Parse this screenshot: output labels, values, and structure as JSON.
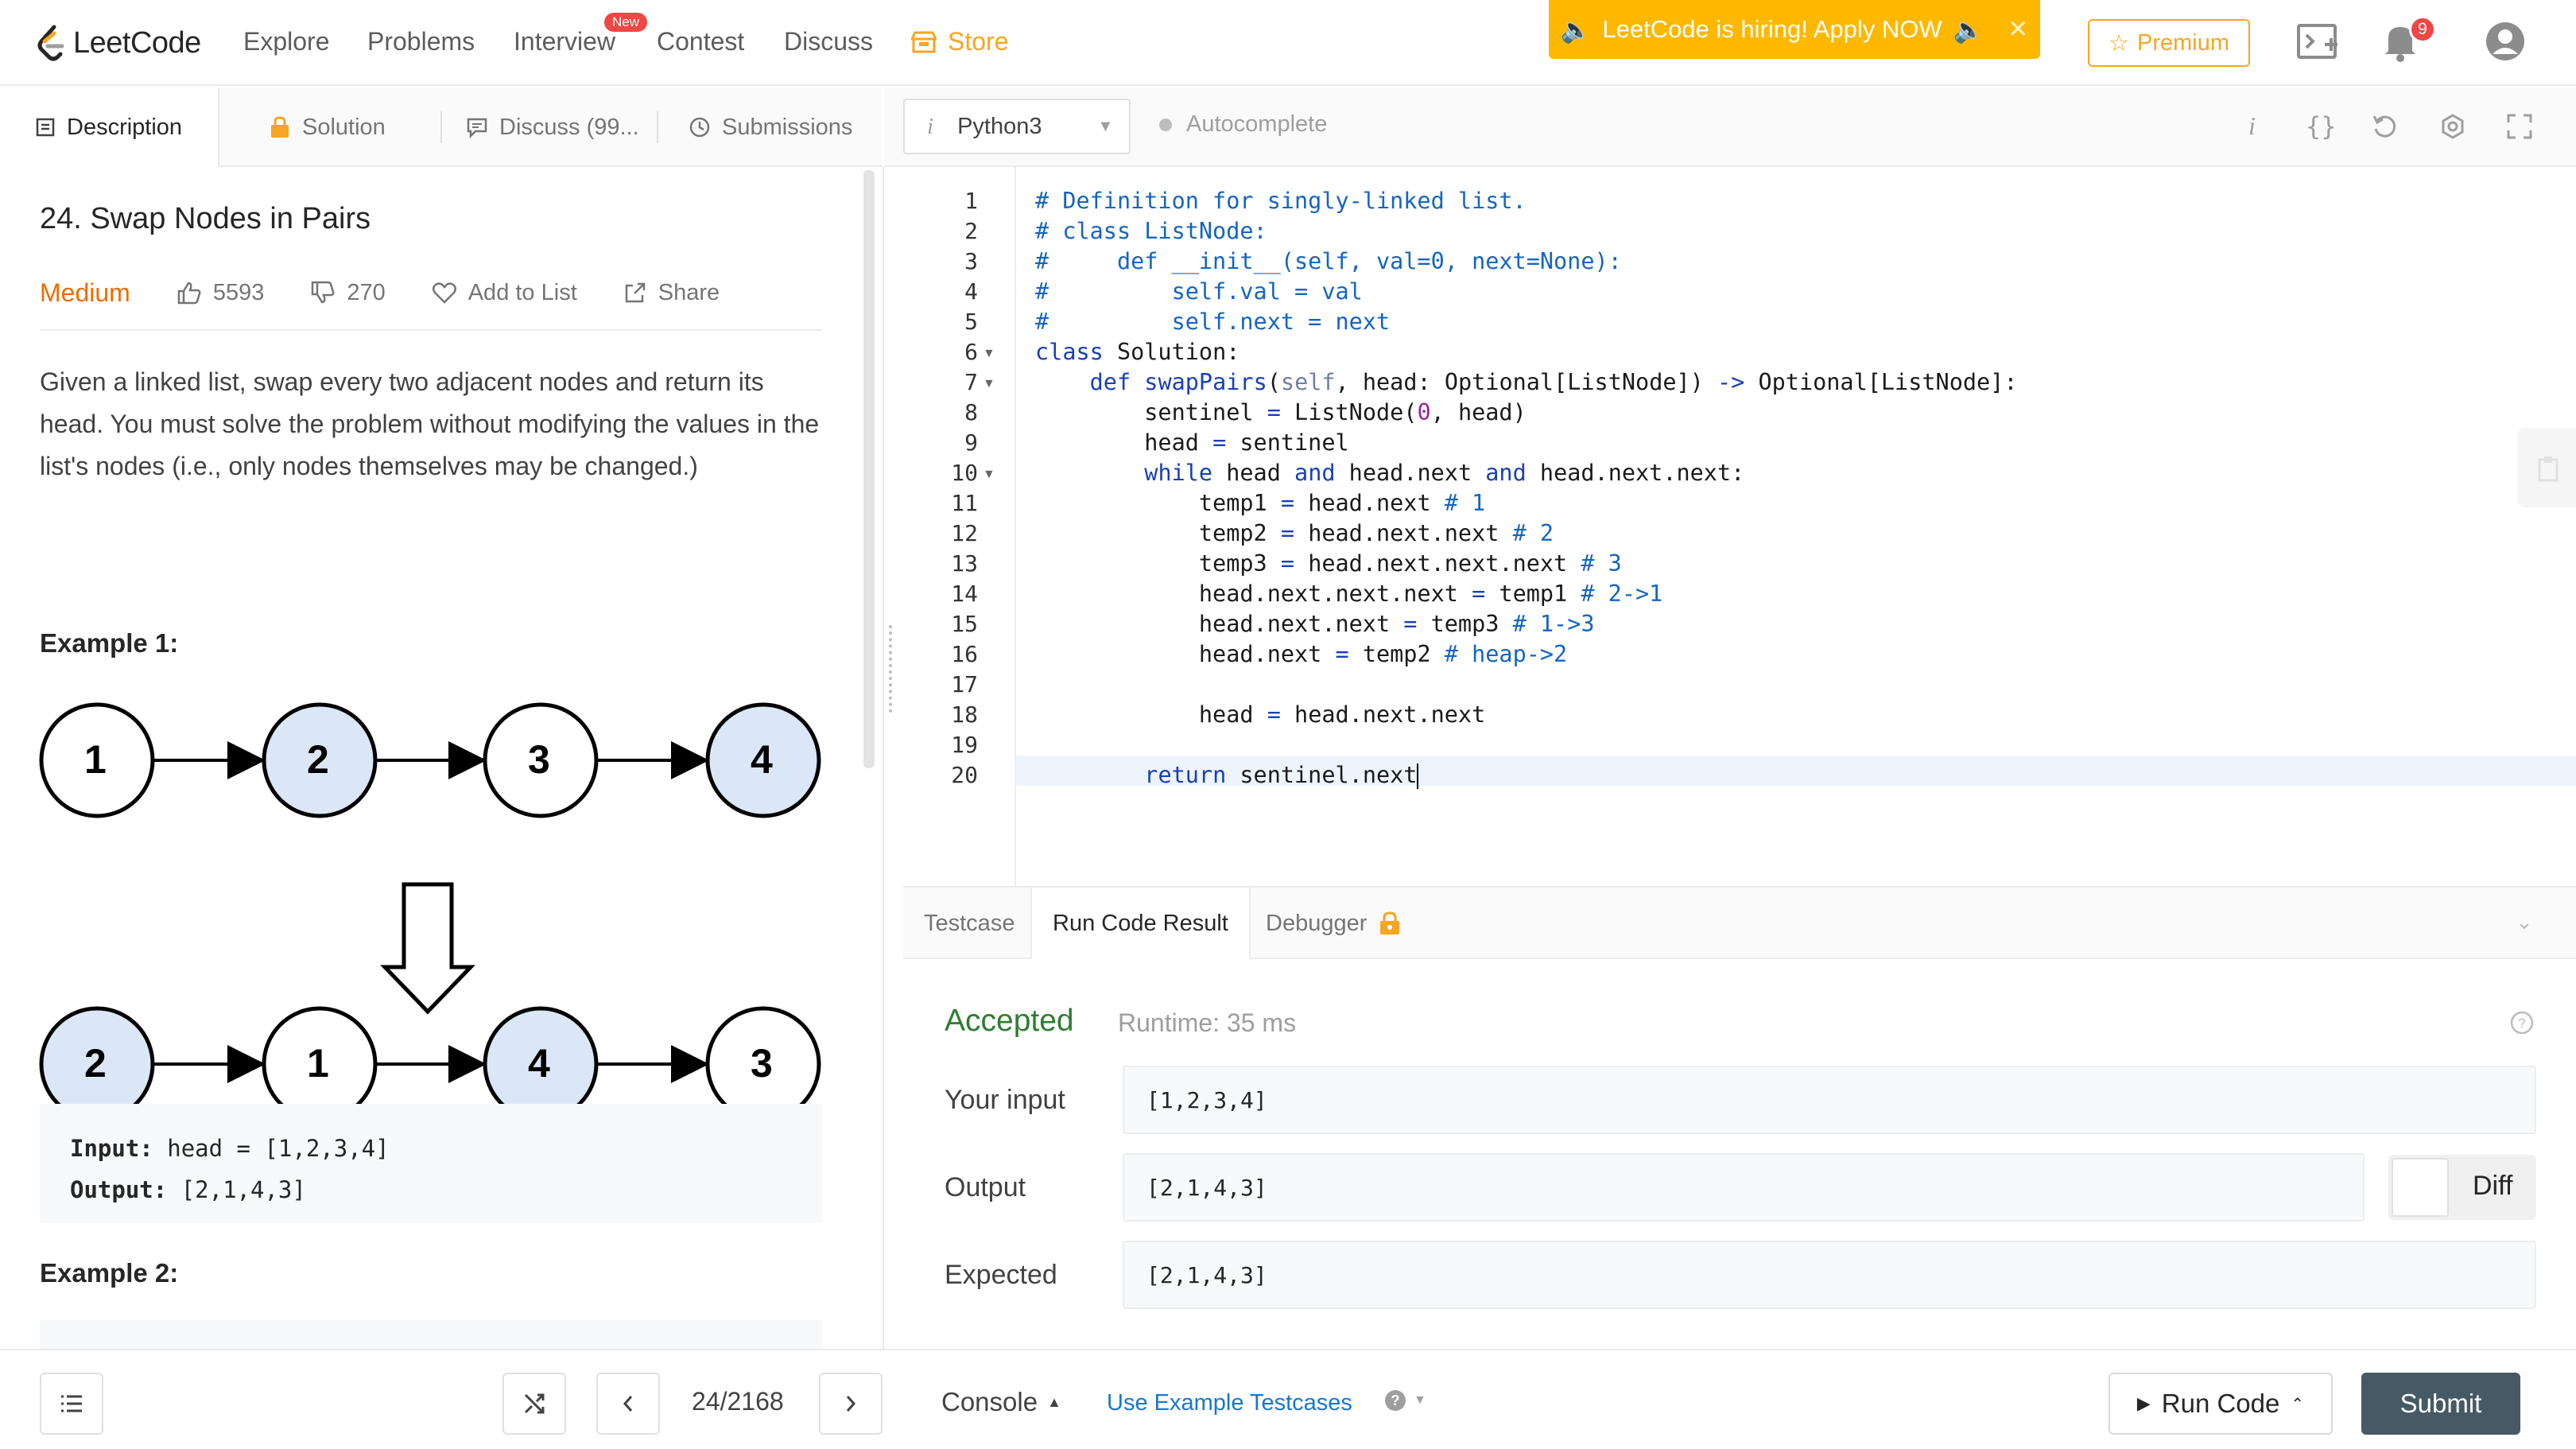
{
  "nav": {
    "logo_text": "LeetCode",
    "items": [
      "Explore",
      "Problems",
      "Interview",
      "Contest",
      "Discuss",
      "Store"
    ],
    "new_badge": "New",
    "hiring_banner": "LeetCode is hiring! Apply NOW",
    "premium_label": "Premium",
    "notification_count": "9"
  },
  "left_tabs": {
    "description": "Description",
    "solution": "Solution",
    "discuss": "Discuss (99...",
    "submissions": "Submissions"
  },
  "problem": {
    "title": "24. Swap Nodes in Pairs",
    "difficulty": "Medium",
    "likes": "5593",
    "dislikes": "270",
    "add_to_list": "Add to List",
    "share": "Share",
    "description": "Given a linked list, swap every two adjacent nodes and return its head. You must solve the problem without modifying the values in the list's nodes (i.e., only nodes themselves may be changed.)",
    "example1_heading": "Example 1:",
    "example2_heading": "Example 2:",
    "diagram_before": [
      "1",
      "2",
      "3",
      "4"
    ],
    "diagram_after": [
      "2",
      "1",
      "4",
      "3"
    ],
    "example1_input_label": "Input:",
    "example1_input": "head = [1,2,3,4]",
    "example1_output_label": "Output:",
    "example1_output": "[2,1,4,3]"
  },
  "editor": {
    "language": "Python3",
    "autocomplete": "Autocomplete",
    "line_numbers": [
      "1",
      "2",
      "3",
      "4",
      "5",
      "6",
      "7",
      "8",
      "9",
      "10",
      "11",
      "12",
      "13",
      "14",
      "15",
      "16",
      "17",
      "18",
      "19",
      "20"
    ]
  },
  "result_tabs": {
    "testcase": "Testcase",
    "run_code_result": "Run Code Result",
    "debugger": "Debugger"
  },
  "result": {
    "status": "Accepted",
    "runtime": "Runtime: 35 ms",
    "your_input_label": "Your input",
    "your_input": "[1,2,3,4]",
    "output_label": "Output",
    "output": "[2,1,4,3]",
    "expected_label": "Expected",
    "expected": "[2,1,4,3]",
    "diff_label": "Diff"
  },
  "bottom": {
    "pager": "24/2168",
    "console": "Console",
    "use_example": "Use Example Testcases",
    "run_code": "Run Code",
    "submit": "Submit"
  },
  "colors": {
    "accent_orange": "#ffb800",
    "accepted_green": "#2e7d32",
    "submit_bg": "#455a64",
    "node_highlight": "#dbe7f6"
  }
}
